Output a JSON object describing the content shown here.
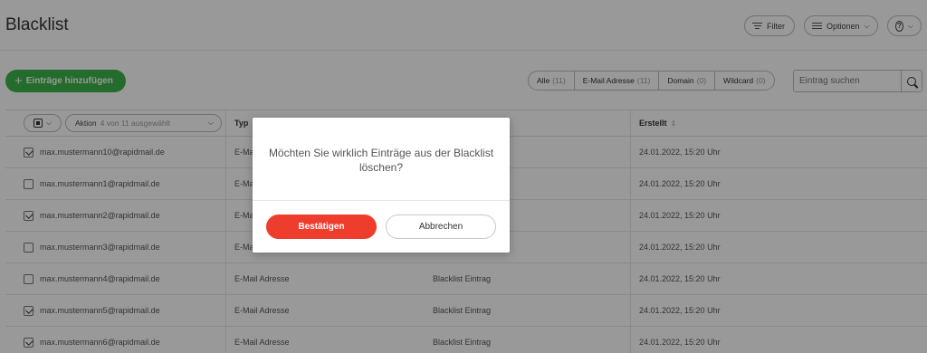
{
  "header": {
    "title": "Blacklist",
    "filter_label": "Filter",
    "options_label": "Optionen"
  },
  "toolbar": {
    "add_label": "Einträge hinzufügen",
    "segments": [
      {
        "label": "Alle",
        "count": "(11)"
      },
      {
        "label": "E-Mail Adresse",
        "count": "(11)"
      },
      {
        "label": "Domain",
        "count": "(0)"
      },
      {
        "label": "Wildcard",
        "count": "(0)"
      }
    ],
    "search_placeholder": "Eintrag suchen"
  },
  "table": {
    "action_label": "Aktion",
    "action_sub": "4 von 11 ausgewählt",
    "col_type": "Typ",
    "col_created": "Erstellt",
    "rows": [
      {
        "email": "max.mustermann10@rapidmail.de",
        "type": "E-Mail Adresse",
        "reason": "Blacklist Eintrag",
        "created": "24.01.2022, 15:20 Uhr",
        "checked": true
      },
      {
        "email": "max.mustermann1@rapidmail.de",
        "type": "E-Mail Adresse",
        "reason": "Blacklist Eintrag",
        "created": "24.01.2022, 15:20 Uhr",
        "checked": false
      },
      {
        "email": "max.mustermann2@rapidmail.de",
        "type": "E-Mail Adresse",
        "reason": "Blacklist Eintrag",
        "created": "24.01.2022, 15:20 Uhr",
        "checked": true
      },
      {
        "email": "max.mustermann3@rapidmail.de",
        "type": "E-Mail Adresse",
        "reason": "Blacklist Eintrag",
        "created": "24.01.2022, 15:20 Uhr",
        "checked": false
      },
      {
        "email": "max.mustermann4@rapidmail.de",
        "type": "E-Mail Adresse",
        "reason": "Blacklist Eintrag",
        "created": "24.01.2022, 15:20 Uhr",
        "checked": false
      },
      {
        "email": "max.mustermann5@rapidmail.de",
        "type": "E-Mail Adresse",
        "reason": "Blacklist Eintrag",
        "created": "24.01.2022, 15:20 Uhr",
        "checked": true
      },
      {
        "email": "max.mustermann6@rapidmail.de",
        "type": "E-Mail Adresse",
        "reason": "Blacklist Eintrag",
        "created": "24.01.2022, 15:20 Uhr",
        "checked": true
      }
    ]
  },
  "dialog": {
    "message": "Möchten Sie wirklich Einträge aus der Blacklist löschen?",
    "confirm_label": "Bestätigen",
    "cancel_label": "Abbrechen"
  },
  "colors": {
    "primary_green": "#3bb54a",
    "danger_red": "#ee3d2d"
  }
}
